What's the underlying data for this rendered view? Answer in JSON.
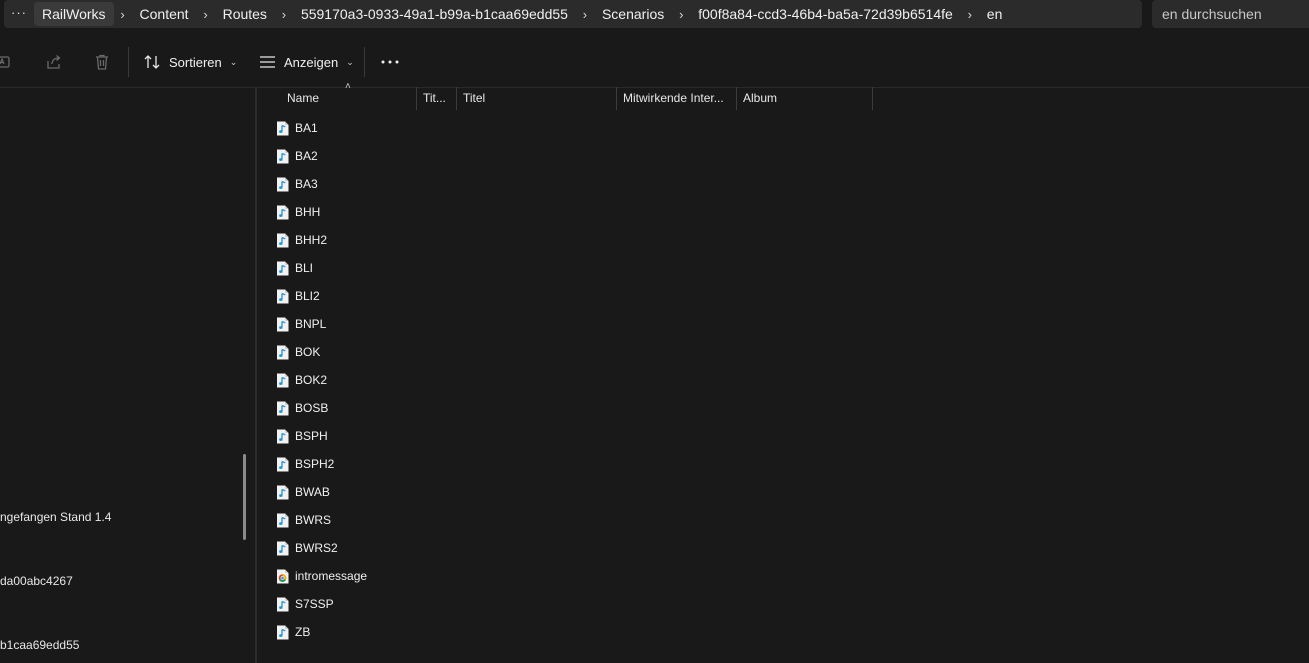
{
  "address_bar": {
    "more_label": "···",
    "separator": "›",
    "crumbs": [
      "RailWorks",
      "Content",
      "Routes",
      "559170a3-0933-49a1-b99a-b1caa69edd55",
      "Scenarios",
      "f00f8a84-ccd3-46b4-ba5a-72d39b6514fe",
      "en"
    ]
  },
  "search": {
    "placeholder": "en durchsuchen"
  },
  "toolbar": {
    "sort_label": "Sortieren",
    "view_label": "Anzeigen",
    "chevron": "⌄",
    "more_label": "···"
  },
  "nav_pane": {
    "items": [
      "ngefangen Stand 1.4",
      "da00abc4267",
      "b1caa69edd55"
    ]
  },
  "columns": {
    "name": "Name",
    "nr": "Tit...",
    "title": "Titel",
    "artists": "Mitwirkende Inter...",
    "album": "Album",
    "sort_arrow": "˄"
  },
  "files": [
    {
      "name": "BA1",
      "icon": "audio-file-icon"
    },
    {
      "name": "BA2",
      "icon": "audio-file-icon"
    },
    {
      "name": "BA3",
      "icon": "audio-file-icon"
    },
    {
      "name": "BHH",
      "icon": "audio-file-icon"
    },
    {
      "name": "BHH2",
      "icon": "audio-file-icon"
    },
    {
      "name": "BLI",
      "icon": "audio-file-icon"
    },
    {
      "name": "BLI2",
      "icon": "audio-file-icon"
    },
    {
      "name": "BNPL",
      "icon": "audio-file-icon"
    },
    {
      "name": "BOK",
      "icon": "audio-file-icon"
    },
    {
      "name": "BOK2",
      "icon": "audio-file-icon"
    },
    {
      "name": "BOSB",
      "icon": "audio-file-icon"
    },
    {
      "name": "BSPH",
      "icon": "audio-file-icon"
    },
    {
      "name": "BSPH2",
      "icon": "audio-file-icon"
    },
    {
      "name": "BWAB",
      "icon": "audio-file-icon"
    },
    {
      "name": "BWRS",
      "icon": "audio-file-icon"
    },
    {
      "name": "BWRS2",
      "icon": "audio-file-icon"
    },
    {
      "name": "intromessage",
      "icon": "chrome-html-file-icon"
    },
    {
      "name": "S7SSP",
      "icon": "audio-file-icon"
    },
    {
      "name": "ZB",
      "icon": "audio-file-icon"
    }
  ],
  "colors": {
    "background": "#191919",
    "address_bg": "#2b2b2b",
    "audio_icon_note": "#1e90d8"
  }
}
